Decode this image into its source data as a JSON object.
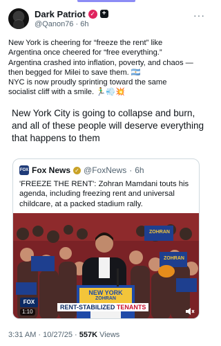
{
  "post": {
    "display_name": "Dark Patriot",
    "handle": "@Qanon76",
    "time": "6h",
    "body_lines": [
      "New York is cheering for “freeze the rent” like",
      "Argentina once cheered for “free everything.”",
      "Argentina crashed into inflation, poverty, and chaos —",
      "then begged for Milei to save them. 🇦🇷",
      "NYC is now proudly sprinting toward the same",
      "socialist cliff with a smile. 🏃‍♂️💨💥"
    ],
    "quoted_lines": [
      "New York City is going to collapse and burn,",
      "and all of these people will deserve everything",
      "that happens to them"
    ],
    "more_icon": "more-dots-icon",
    "verified_icon": "verified-badge-icon",
    "affiliate_icon": "affiliate-badge-icon"
  },
  "quote": {
    "name": "Fox News",
    "handle": "@FoxNews",
    "time": "6h",
    "text_lines": [
      "'FREEZE THE RENT': Zohran Mamdani touts his",
      "agenda, including freezing rent and universal",
      "childcare, at a packed stadium rally."
    ],
    "video": {
      "timestamp": "1:10",
      "channel_badge": "fox",
      "banner_prefix": "RENT-STABILIZED",
      "banner_accent": "TENANTS",
      "podium_line1": "NEW YORK",
      "podium_line2": "ZOHRAN",
      "sign_text": "ZOHRAN",
      "speaker_icon": "volume-icon"
    }
  },
  "meta": {
    "time": "3:31 AM",
    "date": "10/27/25",
    "views_count": "557K",
    "views_label": "Views"
  },
  "colors": {
    "text": "#0f1419",
    "muted": "#536471",
    "border": "#cfd9de",
    "verified": "#e0245e",
    "fox_blue": "#0c2a63"
  }
}
